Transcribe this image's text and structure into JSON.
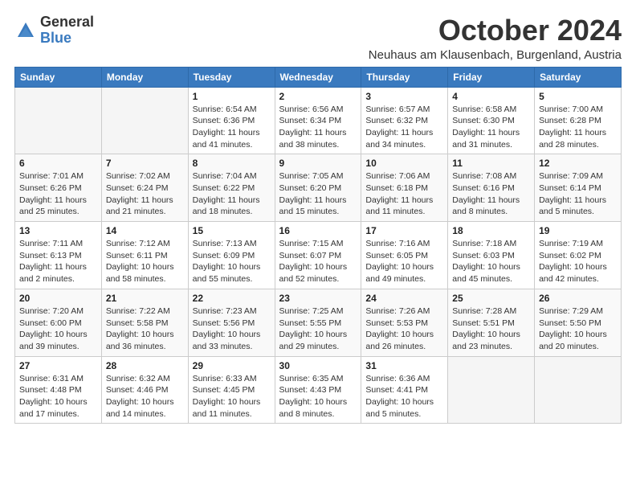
{
  "logo": {
    "general": "General",
    "blue": "Blue"
  },
  "header": {
    "month": "October 2024",
    "location": "Neuhaus am Klausenbach, Burgenland, Austria"
  },
  "weekdays": [
    "Sunday",
    "Monday",
    "Tuesday",
    "Wednesday",
    "Thursday",
    "Friday",
    "Saturday"
  ],
  "weeks": [
    [
      {
        "day": "",
        "info": ""
      },
      {
        "day": "",
        "info": ""
      },
      {
        "day": "1",
        "info": "Sunrise: 6:54 AM\nSunset: 6:36 PM\nDaylight: 11 hours and 41 minutes."
      },
      {
        "day": "2",
        "info": "Sunrise: 6:56 AM\nSunset: 6:34 PM\nDaylight: 11 hours and 38 minutes."
      },
      {
        "day": "3",
        "info": "Sunrise: 6:57 AM\nSunset: 6:32 PM\nDaylight: 11 hours and 34 minutes."
      },
      {
        "day": "4",
        "info": "Sunrise: 6:58 AM\nSunset: 6:30 PM\nDaylight: 11 hours and 31 minutes."
      },
      {
        "day": "5",
        "info": "Sunrise: 7:00 AM\nSunset: 6:28 PM\nDaylight: 11 hours and 28 minutes."
      }
    ],
    [
      {
        "day": "6",
        "info": "Sunrise: 7:01 AM\nSunset: 6:26 PM\nDaylight: 11 hours and 25 minutes."
      },
      {
        "day": "7",
        "info": "Sunrise: 7:02 AM\nSunset: 6:24 PM\nDaylight: 11 hours and 21 minutes."
      },
      {
        "day": "8",
        "info": "Sunrise: 7:04 AM\nSunset: 6:22 PM\nDaylight: 11 hours and 18 minutes."
      },
      {
        "day": "9",
        "info": "Sunrise: 7:05 AM\nSunset: 6:20 PM\nDaylight: 11 hours and 15 minutes."
      },
      {
        "day": "10",
        "info": "Sunrise: 7:06 AM\nSunset: 6:18 PM\nDaylight: 11 hours and 11 minutes."
      },
      {
        "day": "11",
        "info": "Sunrise: 7:08 AM\nSunset: 6:16 PM\nDaylight: 11 hours and 8 minutes."
      },
      {
        "day": "12",
        "info": "Sunrise: 7:09 AM\nSunset: 6:14 PM\nDaylight: 11 hours and 5 minutes."
      }
    ],
    [
      {
        "day": "13",
        "info": "Sunrise: 7:11 AM\nSunset: 6:13 PM\nDaylight: 11 hours and 2 minutes."
      },
      {
        "day": "14",
        "info": "Sunrise: 7:12 AM\nSunset: 6:11 PM\nDaylight: 10 hours and 58 minutes."
      },
      {
        "day": "15",
        "info": "Sunrise: 7:13 AM\nSunset: 6:09 PM\nDaylight: 10 hours and 55 minutes."
      },
      {
        "day": "16",
        "info": "Sunrise: 7:15 AM\nSunset: 6:07 PM\nDaylight: 10 hours and 52 minutes."
      },
      {
        "day": "17",
        "info": "Sunrise: 7:16 AM\nSunset: 6:05 PM\nDaylight: 10 hours and 49 minutes."
      },
      {
        "day": "18",
        "info": "Sunrise: 7:18 AM\nSunset: 6:03 PM\nDaylight: 10 hours and 45 minutes."
      },
      {
        "day": "19",
        "info": "Sunrise: 7:19 AM\nSunset: 6:02 PM\nDaylight: 10 hours and 42 minutes."
      }
    ],
    [
      {
        "day": "20",
        "info": "Sunrise: 7:20 AM\nSunset: 6:00 PM\nDaylight: 10 hours and 39 minutes."
      },
      {
        "day": "21",
        "info": "Sunrise: 7:22 AM\nSunset: 5:58 PM\nDaylight: 10 hours and 36 minutes."
      },
      {
        "day": "22",
        "info": "Sunrise: 7:23 AM\nSunset: 5:56 PM\nDaylight: 10 hours and 33 minutes."
      },
      {
        "day": "23",
        "info": "Sunrise: 7:25 AM\nSunset: 5:55 PM\nDaylight: 10 hours and 29 minutes."
      },
      {
        "day": "24",
        "info": "Sunrise: 7:26 AM\nSunset: 5:53 PM\nDaylight: 10 hours and 26 minutes."
      },
      {
        "day": "25",
        "info": "Sunrise: 7:28 AM\nSunset: 5:51 PM\nDaylight: 10 hours and 23 minutes."
      },
      {
        "day": "26",
        "info": "Sunrise: 7:29 AM\nSunset: 5:50 PM\nDaylight: 10 hours and 20 minutes."
      }
    ],
    [
      {
        "day": "27",
        "info": "Sunrise: 6:31 AM\nSunset: 4:48 PM\nDaylight: 10 hours and 17 minutes."
      },
      {
        "day": "28",
        "info": "Sunrise: 6:32 AM\nSunset: 4:46 PM\nDaylight: 10 hours and 14 minutes."
      },
      {
        "day": "29",
        "info": "Sunrise: 6:33 AM\nSunset: 4:45 PM\nDaylight: 10 hours and 11 minutes."
      },
      {
        "day": "30",
        "info": "Sunrise: 6:35 AM\nSunset: 4:43 PM\nDaylight: 10 hours and 8 minutes."
      },
      {
        "day": "31",
        "info": "Sunrise: 6:36 AM\nSunset: 4:41 PM\nDaylight: 10 hours and 5 minutes."
      },
      {
        "day": "",
        "info": ""
      },
      {
        "day": "",
        "info": ""
      }
    ]
  ]
}
